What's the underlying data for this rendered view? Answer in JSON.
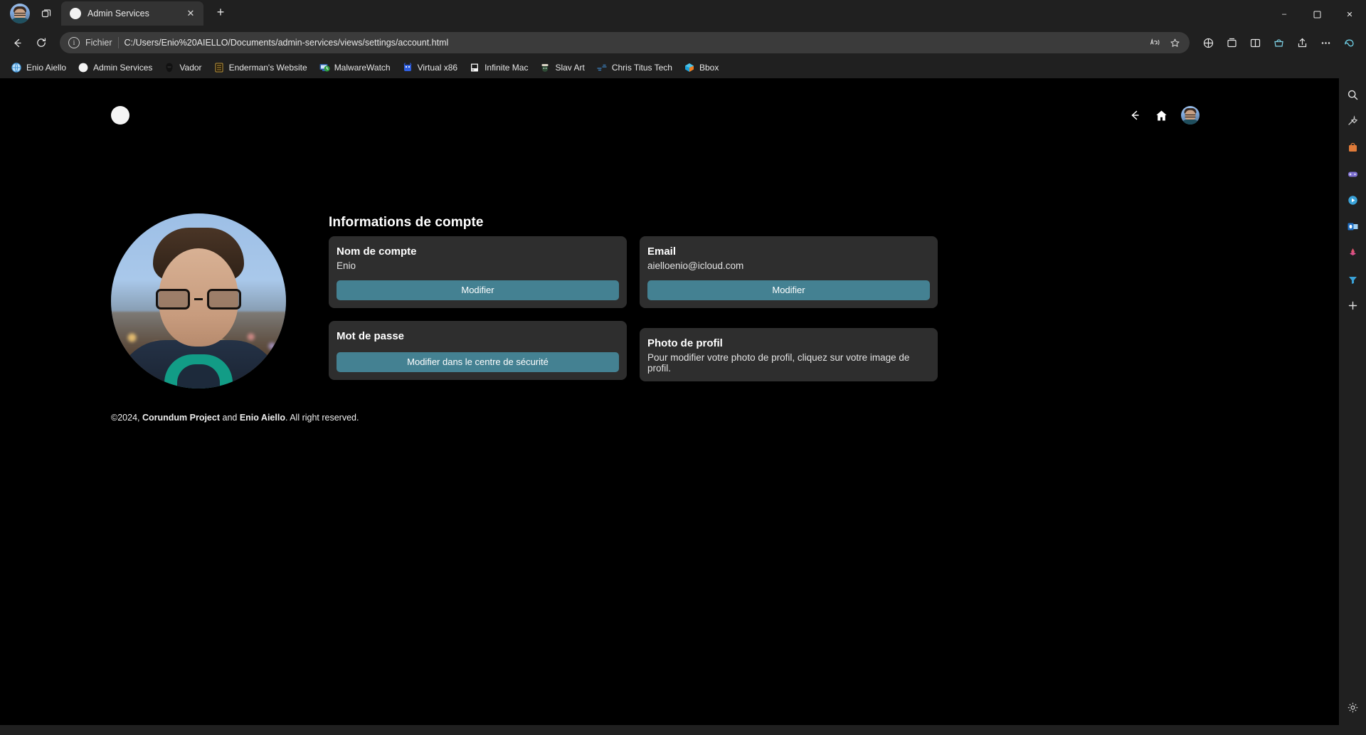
{
  "browser": {
    "tab": {
      "title": "Admin Services",
      "favicon": "circle-favicon",
      "close_label": "✕"
    },
    "new_tab_label": "+",
    "tab_overview_icon": "tab-overview-icon",
    "profile_icon": "profile-avatar-icon",
    "window_controls": {
      "minimize": "–",
      "maximize": "❐",
      "close": "✕"
    },
    "nav": {
      "back_icon": "back-arrow-icon",
      "refresh_icon": "refresh-icon"
    },
    "omnibox": {
      "info_icon": "info-icon",
      "scheme_label": "Fichier",
      "url": "C:/Users/Enio%20AIELLO/Documents/admin-services/views/settings/account.html",
      "read_aloud_icon": "read-aloud-icon",
      "favorite_icon": "star-icon"
    },
    "toolbar_right": {
      "collections_icon": "collections-icon",
      "split_screen_icon": "split-screen-icon",
      "browser_essentials_icon": "browser-essentials-icon",
      "share_icon": "share-icon",
      "settings_more_icon": "more-options-icon",
      "copilot_icon": "copilot-icon"
    },
    "bookmarks": [
      {
        "label": "Enio Aiello",
        "icon": "globe-icon"
      },
      {
        "label": "Admin Services",
        "icon": "circle-white-icon"
      },
      {
        "label": "Vador",
        "icon": "darth-vader-icon"
      },
      {
        "label": "Enderman's Website",
        "icon": "enderman-icon"
      },
      {
        "label": "MalwareWatch",
        "icon": "malware-monitor-icon"
      },
      {
        "label": "Virtual x86",
        "icon": "virtual-x86-icon"
      },
      {
        "label": "Infinite Mac",
        "icon": "classic-mac-icon"
      },
      {
        "label": "Slav Art",
        "icon": "slav-art-icon"
      },
      {
        "label": "Chris Titus Tech",
        "icon": "chris-titus-icon"
      },
      {
        "label": "Bbox",
        "icon": "bbox-icon"
      }
    ],
    "sidebar": [
      {
        "icon": "search-icon"
      },
      {
        "icon": "tools-icon"
      },
      {
        "icon": "shopping-bag-icon"
      },
      {
        "icon": "games-icon"
      },
      {
        "icon": "media-player-icon"
      },
      {
        "icon": "outlook-icon"
      },
      {
        "icon": "image-creator-icon"
      },
      {
        "icon": "drop-icon"
      },
      {
        "icon": "add-tool-icon"
      },
      {
        "icon": "settings-gear-icon"
      }
    ]
  },
  "app": {
    "logo_icon": "app-logo-icon",
    "header": {
      "back_icon": "back-arrow-icon",
      "home_icon": "home-icon",
      "avatar_icon": "user-avatar-icon"
    },
    "avatar_alt": "profile-photo",
    "page_title": "Informations de compte",
    "cards": [
      {
        "name": "account-name",
        "title": "Nom de compte",
        "value": "Enio",
        "button": "Modifier"
      },
      {
        "name": "email",
        "title": "Email",
        "value": "aielloenio@icloud.com",
        "button": "Modifier"
      },
      {
        "name": "password",
        "title": "Mot de passe",
        "value": "",
        "button": "Modifier dans le centre de sécurité"
      },
      {
        "name": "profile-picture",
        "title": "Photo de profil",
        "note": "Pour modifier votre photo de profil, cliquez sur votre image de profil."
      }
    ],
    "footer": {
      "prefix": "©2024, ",
      "org": "Corundum Project",
      "middle": " and ",
      "person": "Enio Aiello",
      "suffix": ". All right reserved."
    },
    "colors": {
      "accent": "#448192",
      "card_bg": "#2e2e2e",
      "page_bg": "#000000"
    }
  }
}
